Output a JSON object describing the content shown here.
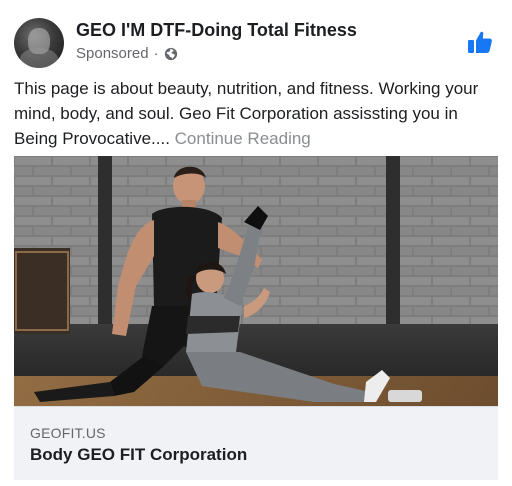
{
  "header": {
    "page_name": "GEO I'M DTF-Doing Total Fitness",
    "sponsored_label": "Sponsored",
    "separator": "·"
  },
  "post": {
    "text": "This page is about beauty, nutrition, and fitness. Working your mind, body, and soul. Geo Fit Corporation assissting you in Being Provocative....",
    "continue_label": "Continue Reading"
  },
  "link_preview": {
    "domain": "GEOFIT.US",
    "title": "Body GEO FIT Corporation"
  },
  "icons": {
    "like": "thumbs-up-icon",
    "audience": "globe-icon"
  },
  "colors": {
    "brand_blue": "#1877f2",
    "secondary_text": "#65676b",
    "continue_text": "#8a8d91",
    "link_box_bg": "#f0f2f5"
  }
}
